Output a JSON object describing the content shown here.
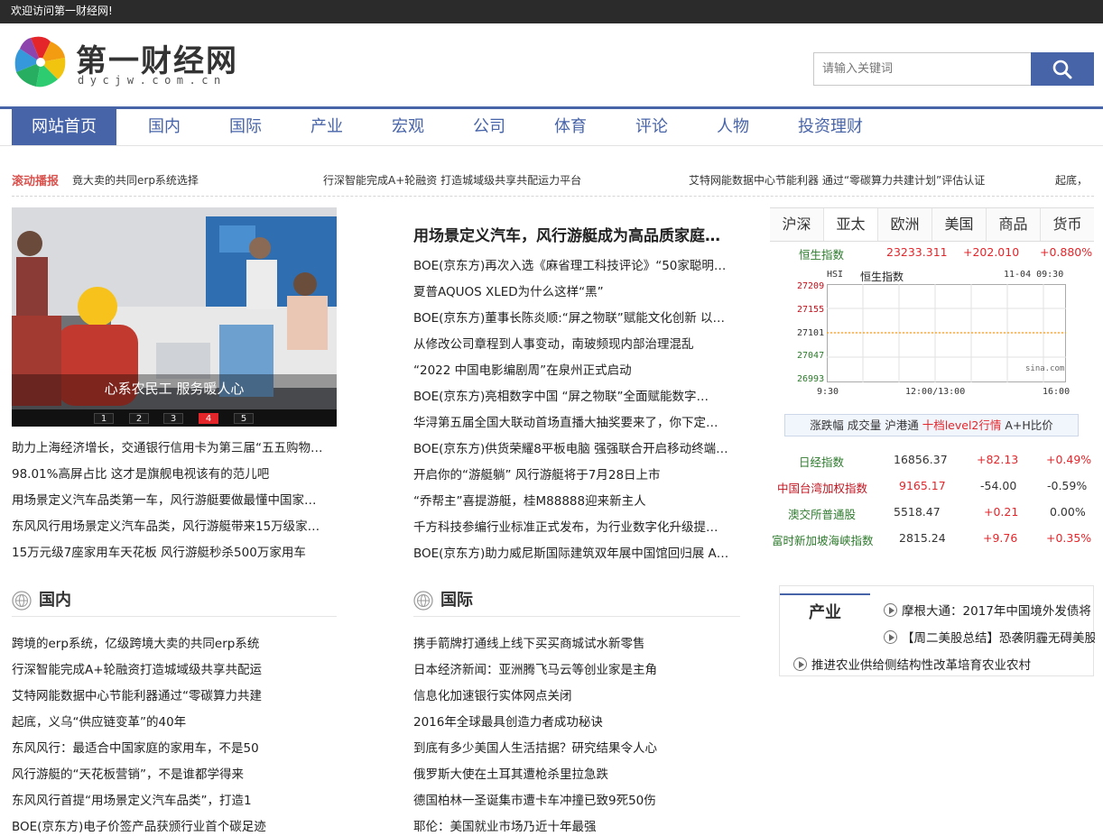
{
  "topbar": {
    "welcome": "欢迎访问第一财经网!"
  },
  "logo": {
    "title": "第一财经网",
    "domain": "dycjw.com.cn"
  },
  "search": {
    "placeholder": "请输入关键词",
    "icon": "search-icon"
  },
  "nav": {
    "items": [
      "网站首页",
      "国内",
      "国际",
      "产业",
      "宏观",
      "公司",
      "体育",
      "评论",
      "人物",
      "投资理财"
    ],
    "active": "网站首页"
  },
  "ticker": {
    "label": "滚动播报",
    "items": [
      "竟大卖的共同erp系统选择",
      "行深智能完成A+轮融资 打造城域级共享共配运力平台",
      "艾特网能数据中心节能利器 通过“零碳算力共建计划”评估认证",
      "起底，"
    ]
  },
  "slider": {
    "caption": "心系农民工 服务暖人心",
    "pages": [
      "1",
      "2",
      "3",
      "4",
      "5"
    ],
    "active_page": "4"
  },
  "left_links": [
    "助力上海经济增长，交通银行信用卡为第三届“五五购物…",
    "98.01%高屏占比 这才是旗舰电视该有的范儿吧",
    "用场景定义汽车品类第一车，风行游艇要做最懂中国家…",
    "东风风行用场景定义汽车品类，风行游艇带来15万级家…",
    "15万元级7座家用车天花板 风行游艇秒杀500万家用车"
  ],
  "headline": "用场景定义汽车，风行游艇成为高品质家庭…",
  "center_links": [
    "BOE(京东方)再次入选《麻省理工科技评论》“50家聪明…",
    "夏普AQUOS XLED为什么这样“黑”",
    "BOE(京东方)董事长陈炎顺:“屏之物联”赋能文化创新 以…",
    "从修改公司章程到人事变动，南玻频现内部治理混乱",
    "“2022 中国电影编剧周”在泉州正式启动",
    "BOE(京东方)亮相数字中国 “屏之物联”全面赋能数字…",
    "华浔第五届全国大联动首场直播大抽奖要来了，你下定…",
    "BOE(京东方)供货荣耀8平板电脑 强强联合开启移动终端…",
    "开启你的“游艇躺” 风行游艇将于7月28日上市",
    "“乔帮主”喜提游艇，桂M88888迎来新主人",
    "千方科技参编行业标准正式发布，为行业数字化升级提…",
    "BOE(京东方)助力威尼斯国际建筑双年展中国馆回归展 A…"
  ],
  "market": {
    "tabs": [
      "沪深",
      "亚太",
      "欧洲",
      "美国",
      "商品",
      "货币"
    ],
    "active_tab": "亚太",
    "hsi_row": {
      "name": "恒生指数",
      "value": "23233.311",
      "change": "+202.010",
      "pct": "+0.880%"
    },
    "chart": {
      "code": "HSI",
      "name": "恒生指数",
      "time": "11-04 09:30",
      "y_ticks": [
        "27209",
        "27155",
        "27101",
        "27047",
        "26993"
      ],
      "x_ticks": [
        "9:30",
        "12:00/13:00",
        "16:00"
      ],
      "watermark": "sina.com"
    },
    "level2": {
      "a": "涨跌幅",
      "b": "成交量",
      "c": "沪港通",
      "d": "十档level2行情",
      "e": "A+H比价"
    },
    "indices": [
      {
        "name": "日经指数",
        "value": "16856.37",
        "change": "+82.13",
        "pct": "+0.49%"
      },
      {
        "name": "中国台湾加权指数",
        "value": "9165.17",
        "change": "-54.00",
        "pct": "-0.59%"
      },
      {
        "name": "澳交所普通股",
        "value": "5518.47",
        "change": "+0.21",
        "pct": "0.00%"
      },
      {
        "name": "富时新加坡海峡指数",
        "value": "2815.24",
        "change": "+9.76",
        "pct": "+0.35%"
      }
    ]
  },
  "section_domestic": {
    "title": "国内",
    "links": [
      "跨境的erp系统，亿级跨境大卖的共同erp系统",
      "行深智能完成A+轮融资打造城域级共享共配运",
      "艾特网能数据中心节能利器通过“零碳算力共建",
      "起底，义乌“供应链变革”的40年",
      "东风风行：最适合中国家庭的家用车，不是50",
      "风行游艇的“天花板营销”，不是谁都学得来",
      "东风风行首提“用场景定义汽车品类”，打造1",
      "BOE(京东方)电子价签产品获颁行业首个碳足迹"
    ]
  },
  "section_international": {
    "title": "国际",
    "links": [
      "携手箭牌打通线上线下买买商城试水新零售",
      "日本经济新闻：亚洲腾飞马云等创业家是主角",
      "信息化加速银行实体网点关闭",
      "2016年全球最具创造力者成功秘诀",
      "到底有多少美国人生活拮据？研究结果令人心",
      "俄罗斯大使在土耳其遭枪杀里拉急跌",
      "德国柏林一圣诞集市遭卡车冲撞已致9死50伤",
      "耶伦：美国就业市场乃近十年最强"
    ]
  },
  "industry": {
    "title": "产业",
    "items": [
      "摩根大通：2017年中国境外发债将",
      "【周二美股总结】恐袭阴霾无碍美股",
      "推进农业供给侧结构性改革培育农业农村"
    ]
  },
  "colors": {
    "brand": "#4864a9",
    "up": "#e4262b",
    "topbar": "#2b2b2b"
  }
}
